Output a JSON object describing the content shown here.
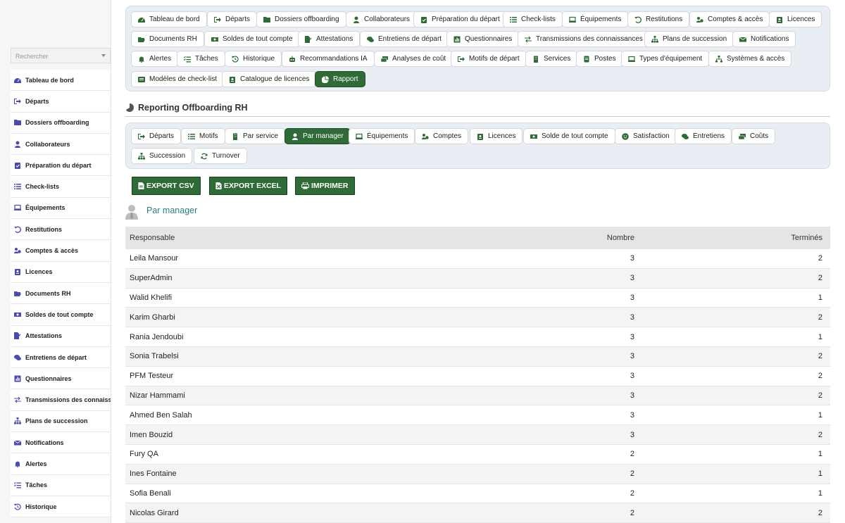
{
  "sidebar": {
    "search_placeholder": "Rechercher",
    "items": [
      {
        "label": "Tableau de bord",
        "icon": "dashboard-icon"
      },
      {
        "label": "Départs",
        "icon": "sign-out-icon"
      },
      {
        "label": "Dossiers offboarding",
        "icon": "folder-user-icon"
      },
      {
        "label": "Collaborateurs",
        "icon": "user-icon"
      },
      {
        "label": "Préparation du départ",
        "icon": "clipboard-check-icon"
      },
      {
        "label": "Check-lists",
        "icon": "list-icon"
      },
      {
        "label": "Équipements",
        "icon": "laptop-icon"
      },
      {
        "label": "Restitutions",
        "icon": "undo-icon"
      },
      {
        "label": "Comptes & accès",
        "icon": "users-cog-icon"
      },
      {
        "label": "Licences",
        "icon": "id-badge-icon"
      },
      {
        "label": "Documents RH",
        "icon": "folder-open-icon"
      },
      {
        "label": "Soldes de tout compte",
        "icon": "money-icon"
      },
      {
        "label": "Attestations",
        "icon": "file-signature-icon"
      },
      {
        "label": "Entretiens de départ",
        "icon": "comments-icon"
      },
      {
        "label": "Questionnaires",
        "icon": "poll-icon"
      },
      {
        "label": "Transmissions des connaiss…",
        "icon": "exchange-icon"
      },
      {
        "label": "Plans de succession",
        "icon": "sitemap-icon"
      },
      {
        "label": "Notifications",
        "icon": "envelope-icon"
      },
      {
        "label": "Alertes",
        "icon": "bell-icon"
      },
      {
        "label": "Tâches",
        "icon": "tasks-icon"
      },
      {
        "label": "Historique",
        "icon": "history-icon"
      }
    ]
  },
  "topnav": {
    "items": [
      {
        "label": "Tableau de bord",
        "icon": "dashboard-icon"
      },
      {
        "label": "Départs",
        "icon": "sign-out-icon"
      },
      {
        "label": "Dossiers offboarding",
        "icon": "folder-user-icon"
      },
      {
        "label": "Collaborateurs",
        "icon": "user-icon"
      },
      {
        "label": "Préparation du départ",
        "icon": "clipboard-check-icon"
      },
      {
        "label": "Check-lists",
        "icon": "list-icon"
      },
      {
        "label": "Équipements",
        "icon": "laptop-icon"
      },
      {
        "label": "Restitutions",
        "icon": "undo-icon"
      },
      {
        "label": "Comptes & accès",
        "icon": "users-cog-icon"
      },
      {
        "label": "Licences",
        "icon": "id-badge-icon"
      },
      {
        "label": "Documents RH",
        "icon": "folder-open-icon"
      },
      {
        "label": "Soldes de tout compte",
        "icon": "money-icon"
      },
      {
        "label": "Attestations",
        "icon": "file-signature-icon"
      },
      {
        "label": "Entretiens de départ",
        "icon": "comments-icon"
      },
      {
        "label": "Questionnaires",
        "icon": "poll-icon"
      },
      {
        "label": "Transmissions des connaissances",
        "icon": "exchange-icon"
      },
      {
        "label": "Plans de succession",
        "icon": "sitemap-icon"
      },
      {
        "label": "Notifications",
        "icon": "envelope-icon"
      },
      {
        "label": "Alertes",
        "icon": "bell-icon"
      },
      {
        "label": "Tâches",
        "icon": "tasks-icon"
      },
      {
        "label": "Historique",
        "icon": "history-icon"
      },
      {
        "label": "Recommandations IA",
        "icon": "robot-icon"
      },
      {
        "label": "Analyses de coût",
        "icon": "money-bills-icon"
      },
      {
        "label": "Motifs de départ",
        "icon": "sign-out-icon"
      },
      {
        "label": "Services",
        "icon": "building-icon"
      },
      {
        "label": "Postes",
        "icon": "id-card-icon"
      },
      {
        "label": "Types d'équipement",
        "icon": "laptop-icon"
      },
      {
        "label": "Systèmes & accès",
        "icon": "network-icon"
      },
      {
        "label": "Modèles de check-list",
        "icon": "list-alt-icon"
      },
      {
        "label": "Catalogue de licences",
        "icon": "id-badge-icon"
      },
      {
        "label": "Rapport",
        "icon": "pie-chart-icon",
        "active": true
      }
    ]
  },
  "section": {
    "title": "Reporting Offboarding RH",
    "icon": "pie-chart-icon"
  },
  "subtabs": {
    "items": [
      {
        "label": "Départs",
        "icon": "sign-out-icon"
      },
      {
        "label": "Motifs",
        "icon": "list-icon"
      },
      {
        "label": "Par service",
        "icon": "building-icon"
      },
      {
        "label": "Par manager",
        "icon": "user-tie-icon",
        "active": true
      },
      {
        "label": "Équipements",
        "icon": "laptop-icon"
      },
      {
        "label": "Comptes",
        "icon": "users-cog-icon"
      },
      {
        "label": "Licences",
        "icon": "id-badge-icon"
      },
      {
        "label": "Solde de tout compte",
        "icon": "money-icon"
      },
      {
        "label": "Satisfaction",
        "icon": "smile-icon"
      },
      {
        "label": "Entretiens",
        "icon": "comments-icon"
      },
      {
        "label": "Coûts",
        "icon": "money-bills-icon"
      },
      {
        "label": "Succession",
        "icon": "sitemap-icon"
      },
      {
        "label": "Turnover",
        "icon": "sync-icon"
      }
    ]
  },
  "exports": {
    "csv": "EXPORT CSV",
    "excel": "EXPORT EXCEL",
    "print": "IMPRIMER"
  },
  "report": {
    "title": "Par manager",
    "columns": [
      "Responsable",
      "Nombre",
      "Terminés"
    ],
    "rows": [
      [
        "Leila Mansour",
        "3",
        "2"
      ],
      [
        "SuperAdmin",
        "3",
        "2"
      ],
      [
        "Walid Khelifi",
        "3",
        "1"
      ],
      [
        "Karim Gharbi",
        "3",
        "2"
      ],
      [
        "Rania Jendoubi",
        "3",
        "1"
      ],
      [
        "Sonia Trabelsi",
        "3",
        "2"
      ],
      [
        "PFM Testeur",
        "3",
        "2"
      ],
      [
        "Nizar Hammami",
        "3",
        "2"
      ],
      [
        "Ahmed Ben Salah",
        "3",
        "1"
      ],
      [
        "Imen Bouzid",
        "3",
        "2"
      ],
      [
        "Fury QA",
        "2",
        "1"
      ],
      [
        "Ines Fontaine",
        "2",
        "1"
      ],
      [
        "Sofia Benali",
        "2",
        "1"
      ],
      [
        "Nicolas Girard",
        "2",
        "2"
      ]
    ]
  },
  "colors": {
    "accent": "#2f6b36",
    "nav_bg": "#e9eef4",
    "report_title": "#2a7f82"
  }
}
